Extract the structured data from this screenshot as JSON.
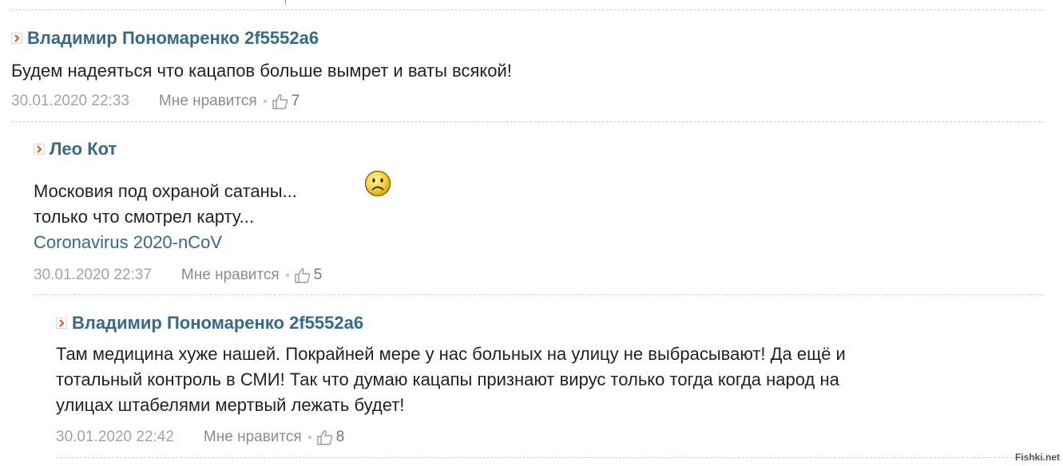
{
  "comments": [
    {
      "author": "Владимир Пономаренко 2f5552a6",
      "text_lines": [
        "Будем надеяться что кацапов больше вымрет и ваты всякой!"
      ],
      "date": "30.01.2020 22:33",
      "like_label": "Мне нравится",
      "like_count": "7"
    },
    {
      "author": "Лео Кот",
      "text_lines": [
        "Московия под охраной сатаны...",
        "только что смотрел карту..."
      ],
      "link_text": "Coronavirus 2020-nCoV",
      "emoticon": "sad-smiley-icon",
      "date": "30.01.2020 22:37",
      "like_label": "Мне нравится",
      "like_count": "5"
    },
    {
      "author": "Владимир Пономаренко 2f5552a6",
      "text_lines": [
        "Там медицина хуже нашей. Покрайней мере у нас больных на улицу не выбрасывают! Да ещё и",
        "тотальный контроль в СМИ! Так что думаю кацапы признают вирус только тогда когда народ на",
        "улицах штабелями мертвый лежать будет!"
      ],
      "date": "30.01.2020 22:42",
      "like_label": "Мне нравится",
      "like_count": "8"
    }
  ],
  "watermark": "Fishki.net",
  "colors": {
    "author": "#336b8c",
    "date": "#a4a4a4",
    "separator": "#cfcfcf"
  }
}
